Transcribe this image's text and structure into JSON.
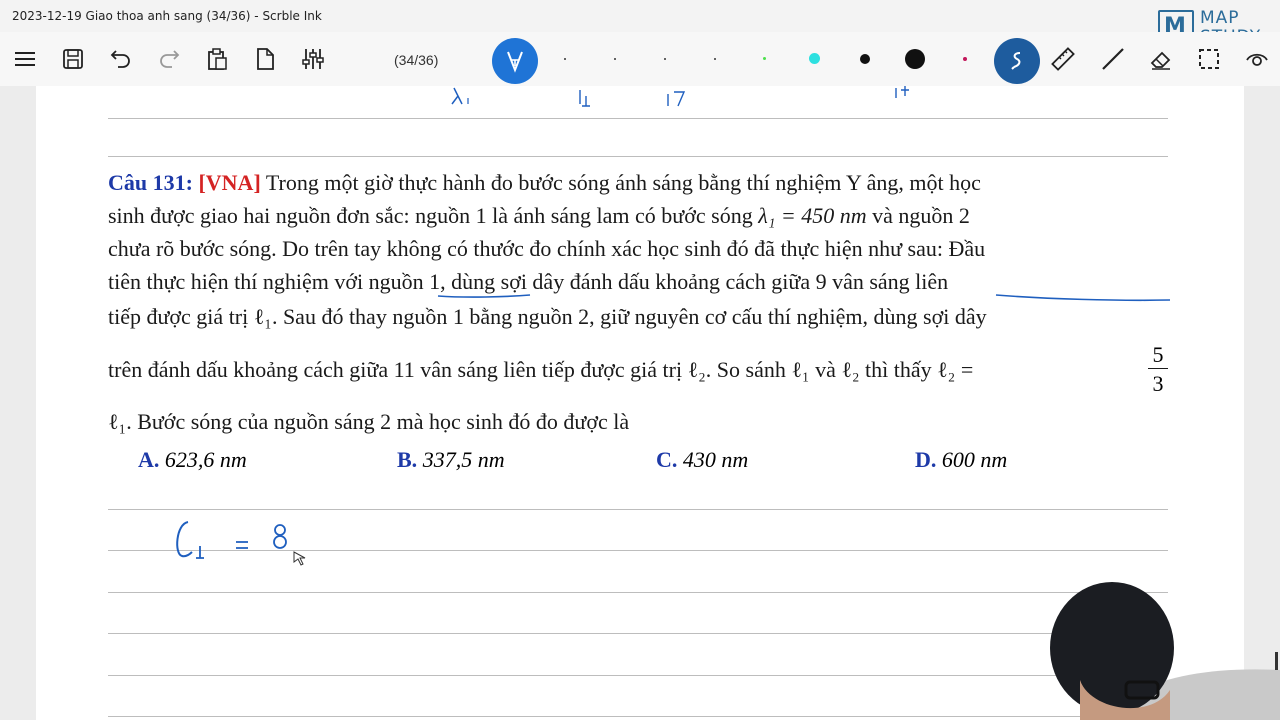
{
  "window": {
    "title": "2023-12-19 Giao thoa anh sang (34/36) - Scrble Ink"
  },
  "logo": {
    "mark": "M",
    "line1": "MAP",
    "line2": "STUDY"
  },
  "toolbar": {
    "page_indicator": "(34/36)",
    "icons": [
      "menu-icon",
      "save-icon",
      "undo-icon",
      "redo-icon",
      "clipboard-icon",
      "new-page-icon",
      "settings-sliders-icon",
      "pen-icon",
      "stroke-size-dots",
      "lasso-icon",
      "ruler-icon",
      "line-icon",
      "eraser-icon",
      "select-icon",
      "view-icon"
    ]
  },
  "handwriting_top": [
    "λ₁",
    "i₁",
    "17",
    "1+"
  ],
  "question": {
    "label": "Câu 131:",
    "source": "[VNA]",
    "line1_text": " Trong một giờ thực hành đo bước sóng ánh sáng bằng thí nghiệm Y âng, một học",
    "line2_pre": "sinh được giao hai nguồn đơn sắc: nguồn 1 là ánh sáng lam có bước sóng ",
    "lambda_expr": "λ₁ = 450 nm",
    "line2_post": " và nguồn 2",
    "line3": "chưa rõ bước sóng. Do trên tay không có thước đo chính xác học sinh đó đã thực hiện như sau: Đầu",
    "line4": "tiên thực hiện thí nghiệm với nguồn 1, dùng sợi dây đánh dấu khoảng cách giữa 9 vân sáng liên",
    "line5": "tiếp được giá trị ℓ₁. Sau đó thay nguồn 1 bằng nguồn 2, giữ nguyên cơ cấu thí nghiệm, dùng sợi dây",
    "line6": "trên đánh dấu khoảng cách giữa 11 vân sáng liên tiếp được giá trị ℓ₂. So sánh ℓ₁ và ℓ₂ thì thấy ℓ₂ =",
    "frac_num": "5",
    "frac_den": "3",
    "line7": "ℓ₁. Bước sóng của nguồn sáng 2 mà học sinh đó đo được là"
  },
  "answers": [
    {
      "letter": "A.",
      "value": "623,6 nm"
    },
    {
      "letter": "B.",
      "value": "337,5 nm"
    },
    {
      "letter": "C.",
      "value": "430 nm"
    },
    {
      "letter": "D.",
      "value": "600 nm"
    }
  ],
  "handwriting_work": "ℓ₁ = 8",
  "colors": {
    "accent": "#1f74d6",
    "question_label": "#1e3aa8",
    "source_tag": "#d42323",
    "ink": "#1f5fbf",
    "highlight_dot": "#2de0e0"
  }
}
